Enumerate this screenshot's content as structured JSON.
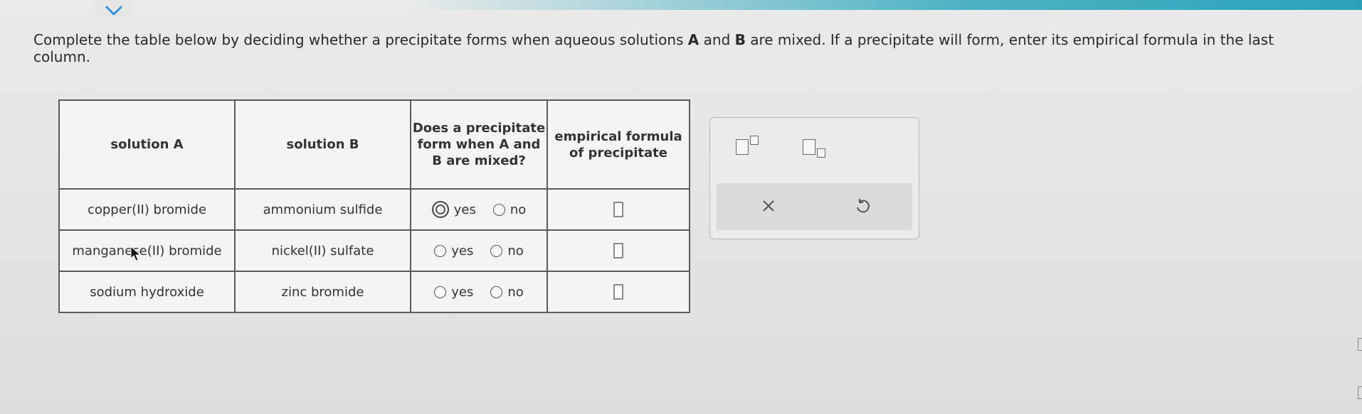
{
  "instructions": {
    "part1": "Complete the table below by deciding whether a precipitate forms when aqueous solutions ",
    "a": "A",
    "part2": " and ",
    "b": "B",
    "part3": " are mixed. If a precipitate will form, enter its empirical formula in the last column."
  },
  "table": {
    "headers": {
      "solution_a": "solution A",
      "solution_b": "solution B",
      "precipitate_q": "Does a precipitate form when A and B are mixed?",
      "formula": "empirical formula of precipitate"
    },
    "rows": [
      {
        "solution_a": "copper(II) bromide",
        "solution_b": "ammonium sulfide",
        "yes": "yes",
        "no": "no",
        "selected": "yes"
      },
      {
        "solution_a": "manganese(II) bromide",
        "solution_b": "nickel(II) sulfate",
        "yes": "yes",
        "no": "no",
        "selected": "none"
      },
      {
        "solution_a": "sodium hydroxide",
        "solution_b": "zinc bromide",
        "yes": "yes",
        "no": "no",
        "selected": "none"
      }
    ]
  },
  "toolbox": {
    "tools": [
      "superscript-icon",
      "subscript-icon"
    ],
    "actions": [
      "clear-icon",
      "undo-icon"
    ]
  },
  "colors": {
    "accent_bar": "#2aa3b8",
    "border": "#5a5a5a"
  }
}
